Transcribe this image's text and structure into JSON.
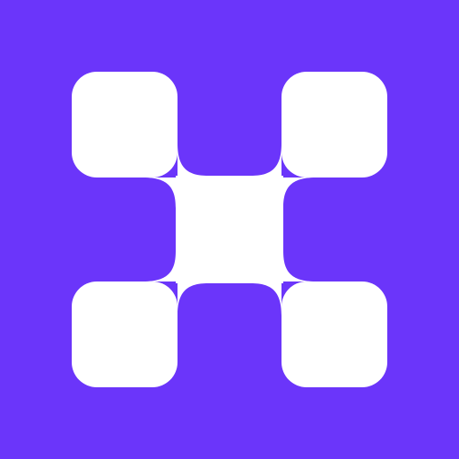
{
  "colors": {
    "background": "#6b35fa",
    "mark": "#ffffff"
  },
  "logo": {
    "icon": "x-shaped-block-logo-icon"
  }
}
